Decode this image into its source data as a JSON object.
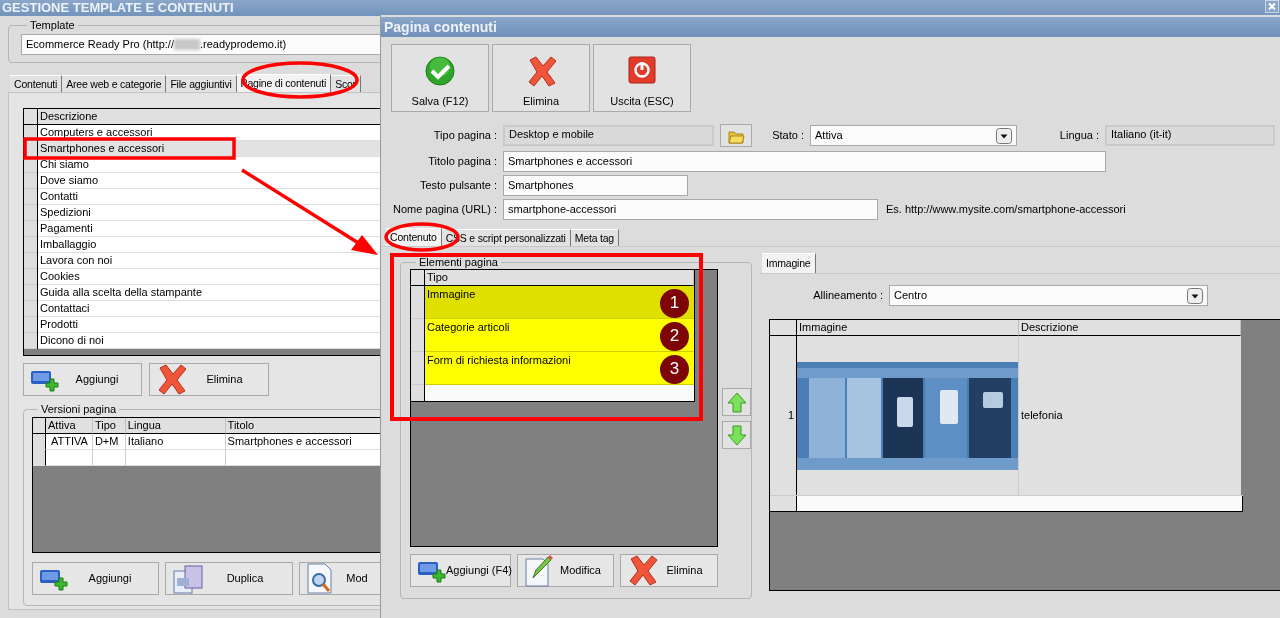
{
  "main_window": {
    "title": "GESTIONE TEMPLATE E CONTENUTI"
  },
  "template": {
    "legend": "Template",
    "value_before_hidden": "Ecommerce Ready Pro (http://",
    "value_after_hidden": ".readyprodemo.it)"
  },
  "main_tabs": [
    {
      "label": "Contenuti",
      "selected": false
    },
    {
      "label": "Aree web e categorie",
      "selected": false
    },
    {
      "label": "File aggiuntivi",
      "selected": false
    },
    {
      "label": "Pagine di contenuti",
      "selected": true
    },
    {
      "label": "Scor",
      "selected": false
    }
  ],
  "pages_table": {
    "columns": [
      "Descrizione"
    ],
    "rows": [
      {
        "descrizione": "Computers e accessori",
        "selected": false
      },
      {
        "descrizione": "Smartphones e accessori",
        "selected": true
      },
      {
        "descrizione": "Chi siamo",
        "selected": false
      },
      {
        "descrizione": "Dove siamo",
        "selected": false
      },
      {
        "descrizione": "Contatti",
        "selected": false
      },
      {
        "descrizione": "Spedizioni",
        "selected": false
      },
      {
        "descrizione": "Pagamenti",
        "selected": false
      },
      {
        "descrizione": "Imballaggio",
        "selected": false
      },
      {
        "descrizione": "Lavora con noi",
        "selected": false
      },
      {
        "descrizione": "Cookies",
        "selected": false
      },
      {
        "descrizione": "Guida alla scelta della stampante",
        "selected": false
      },
      {
        "descrizione": "Contattaci",
        "selected": false
      },
      {
        "descrizione": "Prodotti",
        "selected": false
      },
      {
        "descrizione": "Dicono di noi",
        "selected": false
      }
    ]
  },
  "pages_buttons": [
    {
      "label": "Aggiungi",
      "kind": "add"
    },
    {
      "label": "Elimina",
      "kind": "delete"
    }
  ],
  "versions": {
    "legend": "Versioni pagina",
    "columns": [
      "Attiva",
      "Tipo",
      "Lingua",
      "Titolo"
    ],
    "rows": [
      [
        "ATTIVA",
        "D+M",
        "Italiano",
        "Smartphones e accessori"
      ]
    ],
    "buttons": [
      {
        "label": "Aggiungi",
        "kind": "add"
      },
      {
        "label": "Duplica",
        "kind": "copy"
      },
      {
        "label": "Mod",
        "kind": "preview"
      }
    ]
  },
  "dialog": {
    "title": "Pagina contenuti",
    "toolbar": [
      {
        "label": "Salva (F12)",
        "kind": "save"
      },
      {
        "label": "Elimina",
        "kind": "delete"
      },
      {
        "label": "Uscita (ESC)",
        "kind": "exit"
      }
    ],
    "form": {
      "tipo_pagina": {
        "label": "Tipo pagina :",
        "value": "Desktop e mobile"
      },
      "stato": {
        "label": "Stato :",
        "value": "Attiva"
      },
      "lingua": {
        "label": "Lingua :",
        "value": "Italiano (it-it)"
      },
      "titolo_pagina": {
        "label": "Titolo pagina :",
        "value": "Smartphones e accessori"
      },
      "testo_pulsante": {
        "label": "Testo pulsante :",
        "value": "Smartphones"
      },
      "nome_pagina": {
        "label": "Nome pagina (URL) :",
        "value": "smartphone-accessori",
        "hint": "Es. http://www.mysite.com/smartphone-accessori"
      }
    },
    "tabs": [
      {
        "label": "Contenuto",
        "selected": true
      },
      {
        "label": "CSS e script personalizzati",
        "selected": false
      },
      {
        "label": "Meta tag",
        "selected": false
      }
    ],
    "elements": {
      "legend": "Elementi pagina",
      "columns": [
        "Tipo"
      ],
      "rows": [
        {
          "tipo": "Immagine",
          "badge": "1",
          "selected": true
        },
        {
          "tipo": "Categorie articoli",
          "badge": "2",
          "selected": false
        },
        {
          "tipo": "Form di richiesta informazioni",
          "badge": "3",
          "selected": false
        }
      ]
    },
    "elements_buttons": [
      {
        "label": "Aggiungi (F4)",
        "kind": "add"
      },
      {
        "label": "Modifica",
        "kind": "edit"
      },
      {
        "label": "Elimina",
        "kind": "delete"
      }
    ],
    "element_tabs": [
      {
        "label": "Immagine",
        "selected": true
      }
    ],
    "alignment": {
      "label": "Allineamento :",
      "value": "Centro"
    },
    "images_table": {
      "columns": [
        "Immagine",
        "Descrizione"
      ],
      "rows": [
        {
          "number": "1",
          "descrizione": "telefonia"
        }
      ]
    }
  }
}
